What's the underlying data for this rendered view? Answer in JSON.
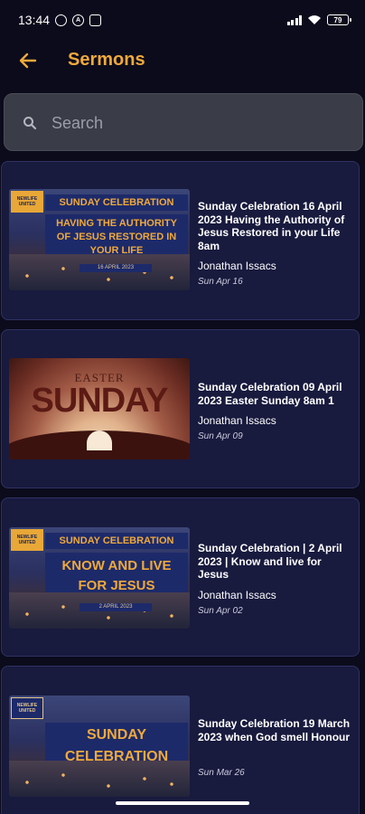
{
  "status_bar": {
    "time": "13:44",
    "battery": "79"
  },
  "header": {
    "title": "Sermons"
  },
  "search": {
    "placeholder": "Search"
  },
  "sermons": [
    {
      "title": "Sunday Celebration  16 April 2023  Having the Authority of Jesus Restored in your Life 8am",
      "author": "Jonathan Issacs",
      "date": "Sun Apr 16",
      "thumb": {
        "logo": "NEWLIFE UNITED",
        "banner": "SUNDAY CELEBRATION",
        "headline": "HAVING THE AUTHORITY OF JESUS RESTORED IN YOUR LIFE",
        "date": "16 APRIL 2023"
      }
    },
    {
      "title": "Sunday Celebration  09 April 2023  Easter Sunday 8am 1",
      "author": "Jonathan Issacs",
      "date": "Sun Apr 09",
      "thumb": {
        "line1": "EASTER",
        "line2": "SUNDAY"
      }
    },
    {
      "title": "Sunday Celebration  | 2 April 2023  | Know and live for Jesus",
      "author": "Jonathan Issacs",
      "date": "Sun Apr 02",
      "thumb": {
        "logo": "NEWLIFE UNITED",
        "banner": "SUNDAY CELEBRATION",
        "headline": "KNOW AND LIVE FOR JESUS",
        "date": "2 APRIL 2023"
      }
    },
    {
      "title": "Sunday Celebration  19 March 2023  when God smell Honour",
      "author": "",
      "date": "Sun Mar 26",
      "thumb": {
        "logo": "NEWLIFE UNITED",
        "headline": "SUNDAY CELEBRATION"
      }
    }
  ],
  "colors": {
    "background": "#0b0b1c",
    "card": "#181a3e",
    "accent": "#f0a93a",
    "search_bg": "#3a3d47"
  }
}
